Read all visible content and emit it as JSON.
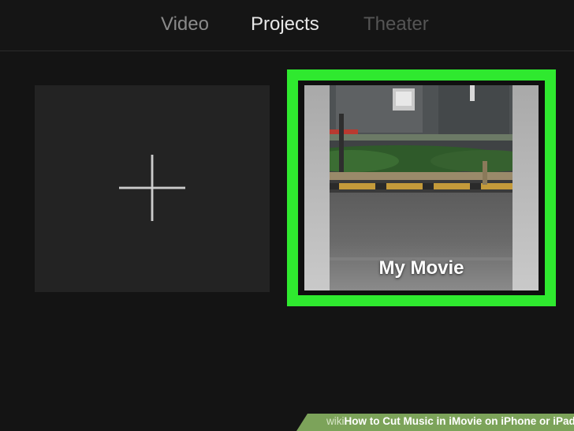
{
  "tabs": {
    "video": "Video",
    "projects": "Projects",
    "theater": "Theater",
    "selected": "Projects"
  },
  "new_project": {
    "icon": "plus-icon"
  },
  "project": {
    "title": "My Movie",
    "highlight_color": "#2fe92f"
  },
  "watermark": {
    "wiki": "wiki",
    "text": "How to Cut Music in iMovie on iPhone or iPad",
    "color": "#7ca35a"
  }
}
